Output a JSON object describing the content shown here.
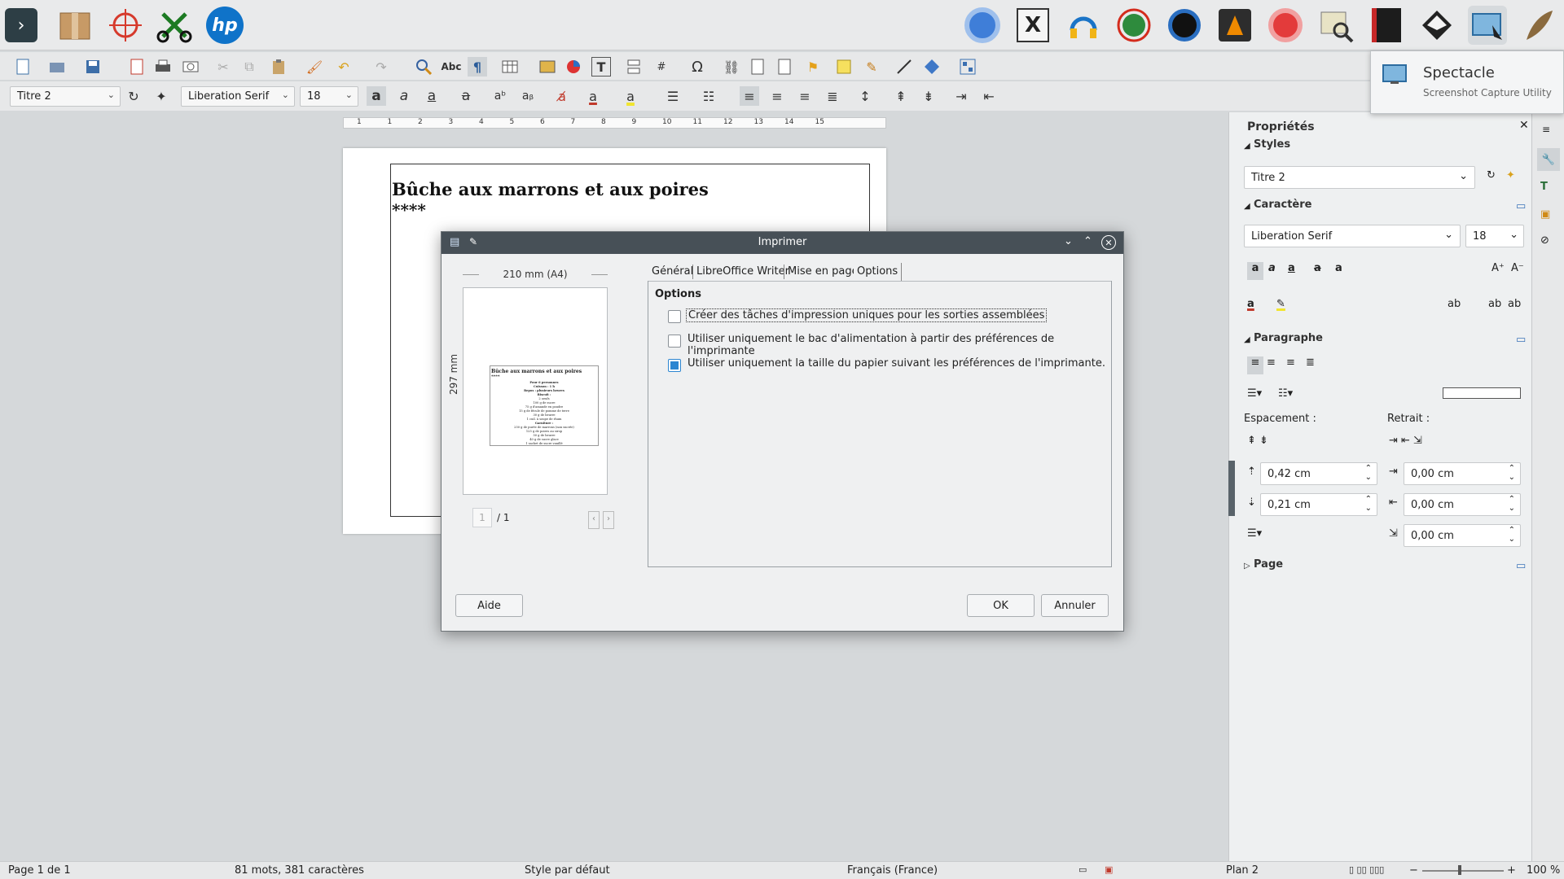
{
  "dock": {
    "icons": [
      "terminal-icon",
      "package-icon",
      "crosshair-icon",
      "scissors-icon",
      "hp-icon",
      "chromium-icon",
      "xsane-icon",
      "audio-icon",
      "globe-icon",
      "camera-icon",
      "vlc-icon",
      "disc-icon",
      "image-viewer-icon",
      "book-icon",
      "inkscape-icon",
      "spectacle-icon",
      "feather-icon"
    ]
  },
  "tooltip": {
    "title": "Spectacle",
    "subtitle": "Screenshot Capture Utility"
  },
  "toolbar2": {
    "style_value": "Titre 2",
    "font_value": "Liberation Serif",
    "size_value": "18"
  },
  "document": {
    "heading": "Bûche aux marrons et aux poires",
    "stars": "****"
  },
  "dialog": {
    "title": "Imprimer",
    "tabs": [
      "Général",
      "LibreOffice Writer",
      "Mise en page",
      "Options"
    ],
    "preview_width_label": "210 mm (A4)",
    "preview_height_label": "297 mm",
    "preview_doc": {
      "title": "Bûche aux marrons et aux poires",
      "stars": "****",
      "lines": [
        "Pour 6 personnes",
        "Cuisson : 1 h",
        "Repos : plusieurs heures",
        "Biscuit :",
        "2 oeufs",
        "100 g de sucre",
        "75 g d'amande en poudre",
        "15 g de fécule de pomme de terre",
        "30 g de beurre",
        "1 cuil. à soupe de rhum",
        "Garniture :",
        "250 g de purée de marrons (non sucrée)",
        "125 g de poires au sirop",
        "50 g de beurre",
        "40 g de sucre glace",
        "1 sachet de sucre vanillé",
        "amandes effilées"
      ]
    },
    "page_current": "1",
    "page_total": "/ 1",
    "options_heading": "Options",
    "options": [
      {
        "label": "Créer des tâches d'impression uniques pour les sorties assemblées",
        "checked": false
      },
      {
        "label": "Utiliser uniquement le bac d'alimentation à partir des préférences de l'imprimante",
        "checked": false
      },
      {
        "label": "Utiliser uniquement la taille du papier suivant les préférences de l'imprimante.",
        "checked": true
      }
    ],
    "help_label": "Aide",
    "ok_label": "OK",
    "cancel_label": "Annuler"
  },
  "sidebar": {
    "title": "Propriétés",
    "styles_heading": "Styles",
    "style_value": "Titre 2",
    "char_heading": "Caractère",
    "font_value": "Liberation Serif",
    "size_value": "18",
    "para_heading": "Paragraphe",
    "spacing_label": "Espacement :",
    "indent_label": "Retrait :",
    "spacing_above": "0,42 cm",
    "spacing_below": "0,21 cm",
    "indent_before": "0,00 cm",
    "indent_after": "0,00 cm",
    "indent_first": "0,00 cm",
    "page_heading": "Page"
  },
  "status": {
    "page": "Page 1 de 1",
    "words": "81 mots, 381 caractères",
    "style": "Style par défaut",
    "language": "Français (France)",
    "outline": "Plan 2",
    "zoom": "100 %"
  },
  "ruler": {
    "ticks": [
      "1",
      "1",
      "2",
      "3",
      "4",
      "5",
      "6",
      "7",
      "8",
      "9",
      "10",
      "11",
      "12",
      "13",
      "14",
      "15"
    ]
  }
}
